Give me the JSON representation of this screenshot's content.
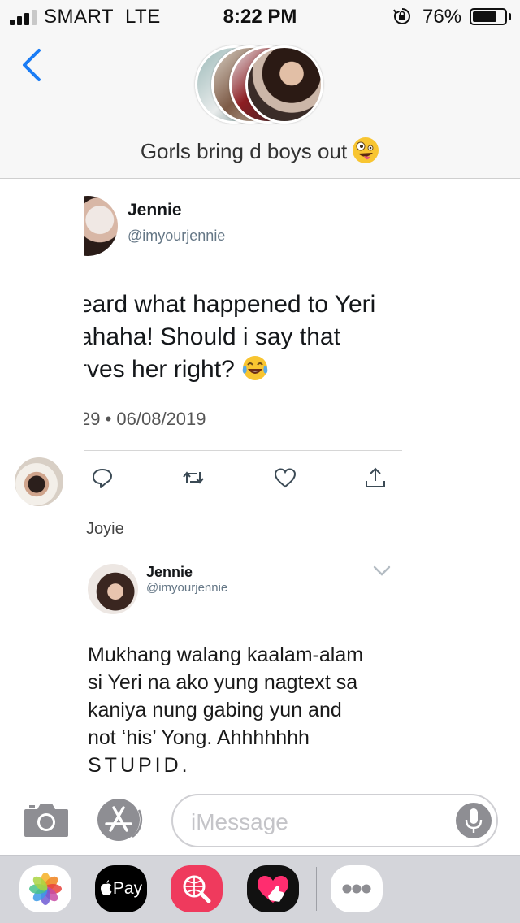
{
  "status_bar": {
    "carrier": "SMART  LTE",
    "time": "8:22 PM",
    "battery_percent": "76%",
    "battery_level": 0.76,
    "signal_bars_filled": 3,
    "signal_bars_total": 4,
    "icons": [
      "signal-icon",
      "orientation-lock-icon",
      "battery-icon"
    ]
  },
  "header": {
    "back_icon": "chevron-left-icon",
    "group_title": "Gorls bring d boys out",
    "title_emoji": "zany-face-emoji",
    "avatar_count": 4
  },
  "tweet_1": {
    "name": "Jennie",
    "handle": "@imyourjennie",
    "text_lines": [
      "eard what happened to Yeri",
      "ahaha! Should i say that",
      "rves her right?"
    ],
    "text_emoji": "tears-of-joy-emoji",
    "meta": "29 • 06/08/2019",
    "actions": [
      "reply-icon",
      "retweet-icon",
      "like-icon",
      "share-icon"
    ]
  },
  "message_sender": {
    "name": "Joyie"
  },
  "tweet_2": {
    "name": "Jennie",
    "handle": "@imyourjennie",
    "text_lines": [
      "Mukhang walang kaalam-alam",
      "si Yeri na ako yung nagtext sa",
      "kaniya nung gabing yun and",
      "not ‘his’ Yong. Ahhhhhhh",
      "STUPID."
    ]
  },
  "composer": {
    "placeholder": "iMessage",
    "icons": [
      "camera-icon",
      "app-store-icon",
      "microphone-icon"
    ]
  },
  "app_drawer": {
    "apple_pay_label": "Pay",
    "apps": [
      "photos-app-icon",
      "apple-pay-app-icon",
      "image-search-app-icon",
      "digital-touch-app-icon",
      "more-apps-icon"
    ]
  },
  "colors": {
    "accent_blue": "#1a7cf5",
    "app_search_red": "#ef3a5d",
    "drawer_gray": "#d4d5da"
  }
}
